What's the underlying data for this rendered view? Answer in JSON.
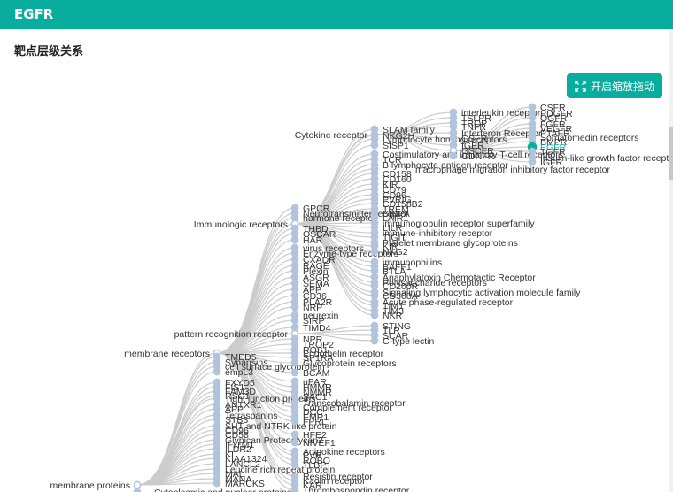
{
  "header": {
    "title": "EGFR"
  },
  "section": {
    "title": "靶点层级关系"
  },
  "toolbar": {
    "zoom_drag_label": "开启缩放拖动",
    "zoom_drag_icon": "expand-icon"
  },
  "colors": {
    "accent": "#09ad9e",
    "node": "#b0c4de",
    "link": "#cccccc",
    "highlight": "#09ad9e"
  },
  "tree": {
    "highlighted": "EGFR",
    "nodes": [
      {
        "label": "membrane proteins",
        "parent": null
      },
      {
        "label": "membrane receptors",
        "parent": 0
      },
      {
        "label": "Cytoplasmic and nuclear proteins",
        "parent": 0
      },
      {
        "label": "TMED5",
        "parent": 0
      },
      {
        "label": "Synapsins",
        "parent": 0
      },
      {
        "label": "cell surface glycoprotein",
        "parent": 0
      },
      {
        "label": "empL3",
        "parent": 0
      },
      {
        "label": "FXYD5",
        "parent": 0
      },
      {
        "label": "FIS1",
        "parent": 0
      },
      {
        "label": "FAM3D",
        "parent": 0
      },
      {
        "label": "RSC1",
        "parent": 0
      },
      {
        "label": "Tight junction proteins",
        "parent": 0
      },
      {
        "label": "ANTXR1",
        "parent": 0
      },
      {
        "label": "APP",
        "parent": 0
      },
      {
        "label": "Tetraspanins",
        "parent": 0
      },
      {
        "label": "STB3",
        "parent": 0
      },
      {
        "label": "SHT and NTRK like protein",
        "parent": 0
      },
      {
        "label": "CD96",
        "parent": 0
      },
      {
        "label": "CD58",
        "parent": 0
      },
      {
        "label": "Glypican Proteoglycan2",
        "parent": 0
      },
      {
        "label": "IFITM1",
        "parent": 0
      },
      {
        "label": "ILDR2",
        "parent": 0
      },
      {
        "label": "KI",
        "parent": 0
      },
      {
        "label": "KIAA1324",
        "parent": 0
      },
      {
        "label": "LANCL2",
        "parent": 0
      },
      {
        "label": "Leucine rich repeat protein",
        "parent": 0
      },
      {
        "label": "MAL",
        "parent": 0
      },
      {
        "label": "MANA",
        "parent": 0
      },
      {
        "label": "MARCKS",
        "parent": 0
      },
      {
        "label": "GPCR",
        "parent": 1
      },
      {
        "label": "Neurotransmitter receptor",
        "parent": 1
      },
      {
        "label": "hormone receptor",
        "parent": 1
      },
      {
        "label": "Immunologic receptors",
        "parent": 1
      },
      {
        "label": "THBD",
        "parent": 1
      },
      {
        "label": "OSCAR",
        "parent": 1
      },
      {
        "label": "HAR",
        "parent": 1
      },
      {
        "label": "virus receptors",
        "parent": 1
      },
      {
        "label": "Enzyme-type receptors",
        "parent": 1
      },
      {
        "label": "CXADR",
        "parent": 1
      },
      {
        "label": "RAGE",
        "parent": 1
      },
      {
        "label": "Plexin",
        "parent": 1
      },
      {
        "label": "ASGR",
        "parent": 1
      },
      {
        "label": "SEMA",
        "parent": 1
      },
      {
        "label": "APP",
        "parent": 1
      },
      {
        "label": "CD36",
        "parent": 1
      },
      {
        "label": "PLA2R",
        "parent": 1
      },
      {
        "label": "NRP",
        "parent": 1
      },
      {
        "label": "neurexin",
        "parent": 1
      },
      {
        "label": "SIRP",
        "parent": 1
      },
      {
        "label": "TIMD4",
        "parent": 1
      },
      {
        "label": "pattern recognition receptor",
        "parent": 1
      },
      {
        "label": "NPR",
        "parent": 1
      },
      {
        "label": "TROP2",
        "parent": 1
      },
      {
        "label": "ROS1",
        "parent": 1
      },
      {
        "label": "Endothelin receptor",
        "parent": 1
      },
      {
        "label": "SP1RA",
        "parent": 1
      },
      {
        "label": "Glycoprotein receptors",
        "parent": 1
      },
      {
        "label": "BCAM",
        "parent": 1
      },
      {
        "label": "uPAR",
        "parent": 1
      },
      {
        "label": "HMMR",
        "parent": 1
      },
      {
        "label": "NMMR",
        "parent": 1
      },
      {
        "label": "SAC1",
        "parent": 1
      },
      {
        "label": "Transcobalamin receptor",
        "parent": 1
      },
      {
        "label": "Complement receptor",
        "parent": 1
      },
      {
        "label": "DCC",
        "parent": 1
      },
      {
        "label": "EMR1",
        "parent": 1
      },
      {
        "label": "FPRL",
        "parent": 1
      },
      {
        "label": "HFE2",
        "parent": 1
      },
      {
        "label": "NIVEF1",
        "parent": 1
      },
      {
        "label": "Adipokine receptors",
        "parent": 1
      },
      {
        "label": "PVR",
        "parent": 1
      },
      {
        "label": "ROBO",
        "parent": 1
      },
      {
        "label": "TLBP",
        "parent": 1
      },
      {
        "label": "Resistin receptor",
        "parent": 1
      },
      {
        "label": "Kaolin receptor",
        "parent": 1
      },
      {
        "label": "KAR",
        "parent": 1
      },
      {
        "label": "Thrombospondin receptor",
        "parent": 1
      },
      {
        "label": "SLAM family",
        "parent": 32
      },
      {
        "label": "Cytokine receptor",
        "parent": 32
      },
      {
        "label": "NKG2H",
        "parent": 32
      },
      {
        "label": "Lymphocyte homing receptors",
        "parent": 32
      },
      {
        "label": "SISP1",
        "parent": 32
      },
      {
        "label": "Costimulatory and inhibitory T-cell receptors",
        "parent": 32
      },
      {
        "label": "TCR",
        "parent": 32
      },
      {
        "label": "B lymphocyte antigen receptor",
        "parent": 32
      },
      {
        "label": "macrophage migration inhibitory factor receptor",
        "parent": 32
      },
      {
        "label": "CD158",
        "parent": 32
      },
      {
        "label": "CD160",
        "parent": 32
      },
      {
        "label": "KIR",
        "parent": 32
      },
      {
        "label": "CD79",
        "parent": 32
      },
      {
        "label": "CD96",
        "parent": 32
      },
      {
        "label": "PVRIG",
        "parent": 32
      },
      {
        "label": "CD158B2",
        "parent": 32
      },
      {
        "label": "TREM",
        "parent": 32
      },
      {
        "label": "SIRPA",
        "parent": 32
      },
      {
        "label": "LAIR1",
        "parent": 32
      },
      {
        "label": "immunoglobulin receptor superfamily",
        "parent": 32
      },
      {
        "label": "LILR",
        "parent": 32
      },
      {
        "label": "immune-inhibitory receptor",
        "parent": 32
      },
      {
        "label": "TIGIT",
        "parent": 32
      },
      {
        "label": "Platelet membrane glycoproteins",
        "parent": 32
      },
      {
        "label": "KIR",
        "parent": 32
      },
      {
        "label": "NKG2",
        "parent": 32
      },
      {
        "label": "immunophilins",
        "parent": 32
      },
      {
        "label": "BAFF1",
        "parent": 32
      },
      {
        "label": "BTLA",
        "parent": 32
      },
      {
        "label": "Anaphylatoxin Chemotactic Receptor",
        "parent": 32
      },
      {
        "label": "Polysaccharide receptors",
        "parent": 32
      },
      {
        "label": "CD200R",
        "parent": 32
      },
      {
        "label": "Signaling lymphocytic activation molecule family",
        "parent": 32
      },
      {
        "label": "CD300A",
        "parent": 32
      },
      {
        "label": "Acute phase-regulated receptor",
        "parent": 32
      },
      {
        "label": "TIM1",
        "parent": 32
      },
      {
        "label": "TIM3",
        "parent": 32
      },
      {
        "label": "NKR",
        "parent": 32
      },
      {
        "label": "STING",
        "parent": 50
      },
      {
        "label": "TLR",
        "parent": 50
      },
      {
        "label": "SCAR",
        "parent": 50
      },
      {
        "label": "C-type lectin",
        "parent": 50
      },
      {
        "label": "interleukin receptor",
        "parent": 78
      },
      {
        "label": "TSLPR",
        "parent": 78
      },
      {
        "label": "TROP",
        "parent": 78
      },
      {
        "label": "TNFR",
        "parent": 78
      },
      {
        "label": "Interferon Receptor",
        "parent": 78
      },
      {
        "label": "GSFR",
        "parent": 78
      },
      {
        "label": "IGER",
        "parent": 78
      },
      {
        "label": "GSCFR",
        "parent": 78
      },
      {
        "label": "GDNFR",
        "parent": 78
      },
      {
        "label": "CSFR",
        "parent": 126
      },
      {
        "label": "PDGFR",
        "parent": 126
      },
      {
        "label": "OGFR",
        "parent": 126
      },
      {
        "label": "FGFR",
        "parent": 126
      },
      {
        "label": "VEGFR",
        "parent": 126
      },
      {
        "label": "PTAFR",
        "parent": 126
      },
      {
        "label": "Somatomedin receptors",
        "parent": 126
      },
      {
        "label": "BMPR",
        "parent": 126
      },
      {
        "label": "EGFR",
        "parent": 126
      },
      {
        "label": "TGFR",
        "parent": 126
      },
      {
        "label": "Insulin-like growth factor recepto",
        "parent": 126
      },
      {
        "label": "IGFR",
        "parent": 126
      }
    ]
  }
}
